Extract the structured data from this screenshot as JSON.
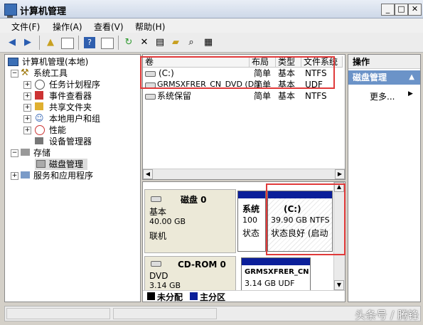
{
  "window": {
    "title": "计算机管理",
    "controls": {
      "minimize": "_",
      "maximize": "□",
      "close": "✕"
    }
  },
  "menu": [
    "文件(F)",
    "操作(A)",
    "查看(V)",
    "帮助(H)"
  ],
  "tree": {
    "root": "计算机管理(本地)",
    "system_tools": "系统工具",
    "items": [
      "任务计划程序",
      "事件查看器",
      "共享文件夹",
      "本地用户和组",
      "性能",
      "设备管理器"
    ],
    "storage": "存储",
    "disk_mgmt": "磁盘管理",
    "services": "服务和应用程序"
  },
  "volumes": {
    "columns": [
      "卷",
      "布局",
      "类型",
      "文件系统"
    ],
    "rows": [
      {
        "name": "(C:)",
        "layout": "简单",
        "type": "基本",
        "fs": "NTFS"
      },
      {
        "name": "GRMSXFRER_CN_DVD (D:)",
        "layout": "简单",
        "type": "基本",
        "fs": "UDF"
      },
      {
        "name": "系统保留",
        "layout": "简单",
        "type": "基本",
        "fs": "NTFS"
      }
    ]
  },
  "disk0": {
    "name": "磁盘 0",
    "kind": "基本",
    "size": "40.00 GB",
    "status": "联机",
    "part1": {
      "name": "系统",
      "size": "100",
      "status": "状态"
    },
    "part2": {
      "name": "(C:)",
      "size": "39.90 GB NTFS",
      "status": "状态良好 (启动"
    }
  },
  "cdrom": {
    "name": "CD-ROM 0",
    "kind": "DVD",
    "size": "3.14 GB",
    "part": {
      "name": "GRMSXFRER_CN",
      "size": "3.14 GB UDF"
    }
  },
  "legend": {
    "unallocated": "未分配",
    "primary": "主分区"
  },
  "actions": {
    "header": "操作",
    "section": "磁盘管理",
    "more": "更多..."
  },
  "watermark": "头条号 / 腾锋",
  "colors": {
    "primary_partition": "#0b1f9a",
    "unallocated": "#000000",
    "highlight": "#e03a3a",
    "section_blue": "#6b93c8"
  }
}
